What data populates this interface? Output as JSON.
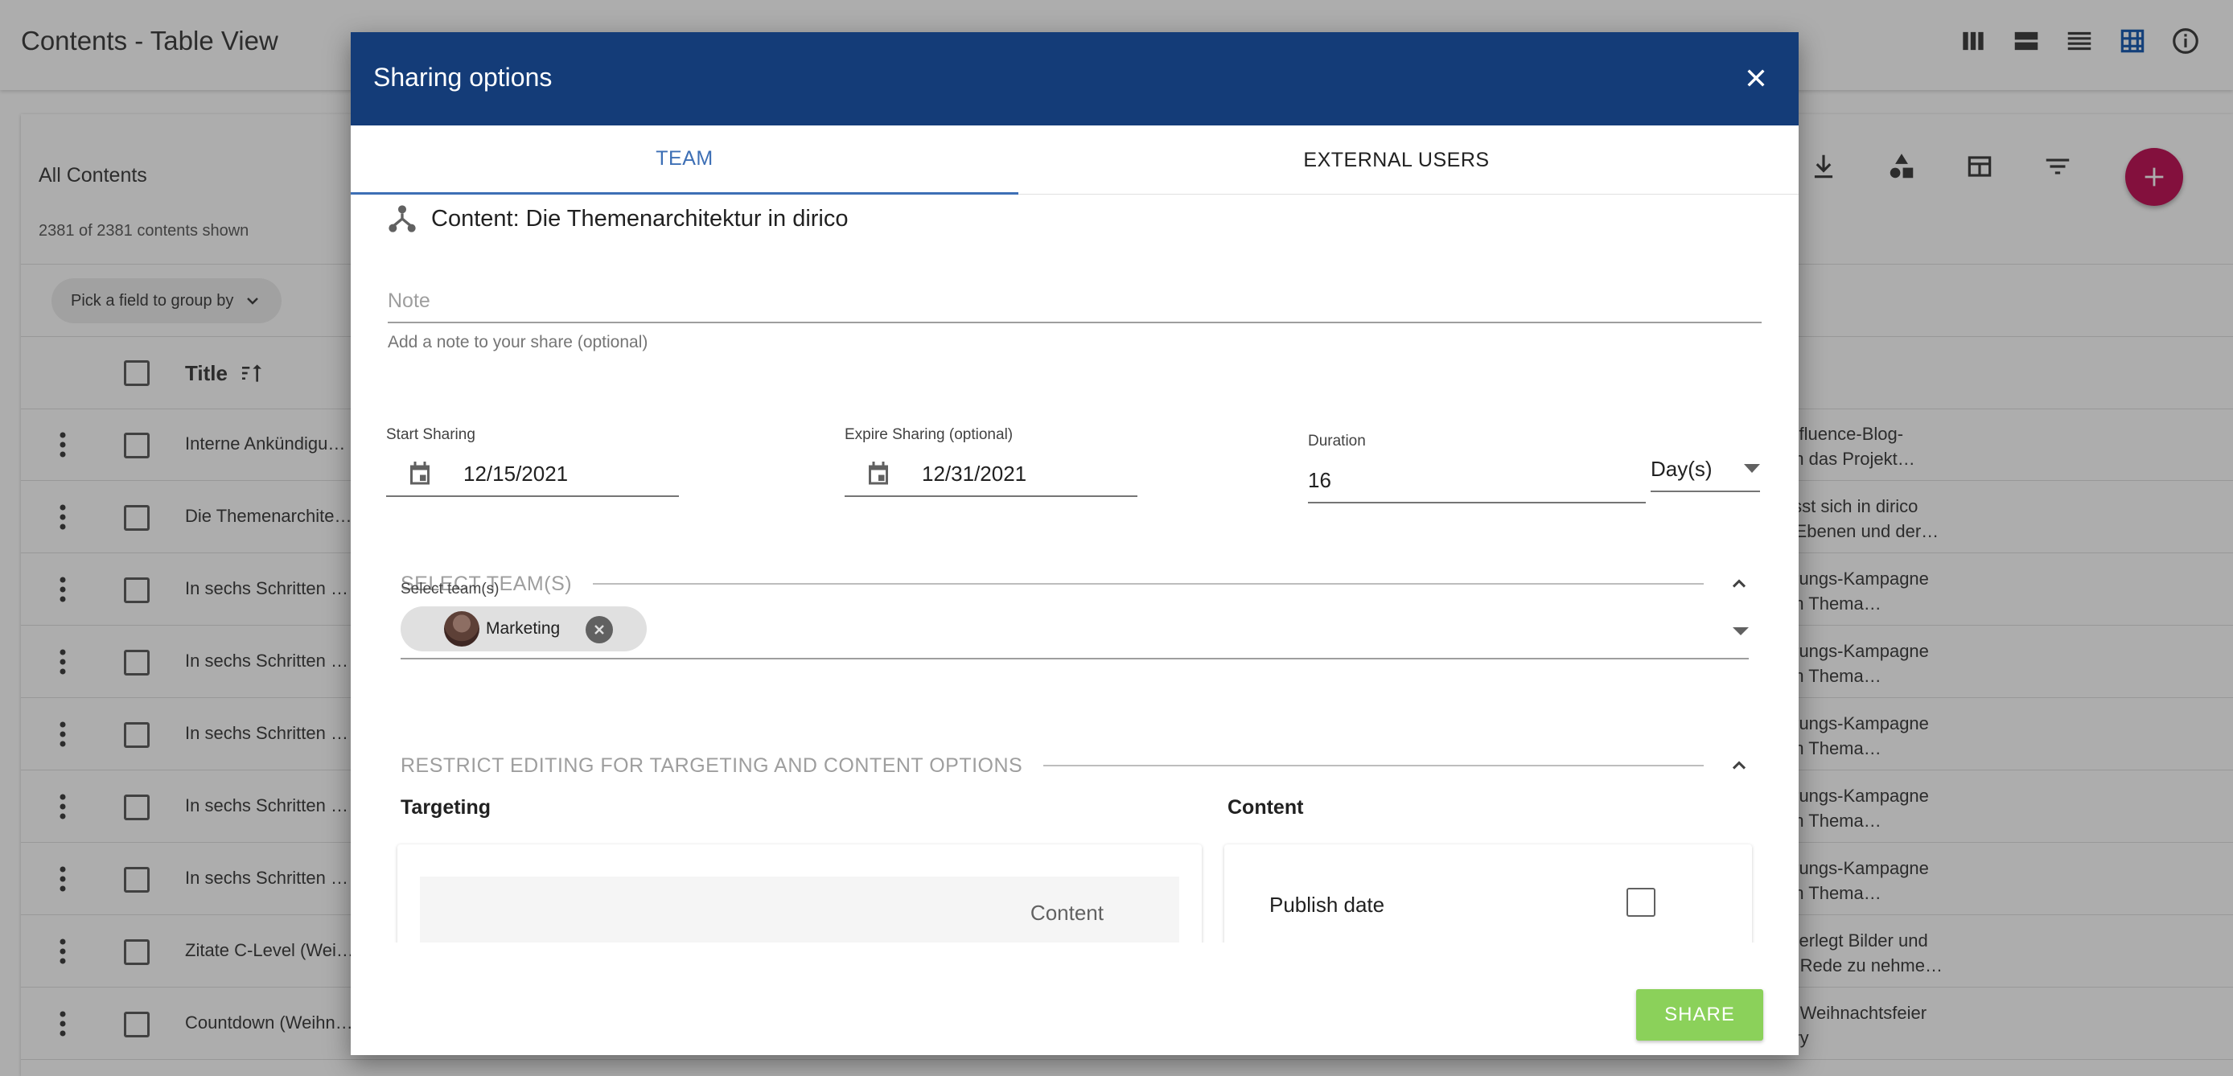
{
  "app": {
    "title": "Contents - Table View",
    "list_title": "All Contents",
    "count_text": "2381 of 2381 contents shown",
    "group_by_label": "Pick a field to group by",
    "column_title": "Title",
    "accent_color": "#c2185b"
  },
  "rows": [
    {
      "title": "Interne Ankündigu…",
      "desc1": "onfluence-Blog-",
      "desc2": "am das Projekt…"
    },
    {
      "title": "Die Themenarchite…",
      "desc1": "lässt sich in dirico",
      "desc2": "e-Ebenen und der…"
    },
    {
      "title": "In sechs Schritten …",
      "desc1": "ierungs-Kampagne",
      "desc2": "um Thema…"
    },
    {
      "title": "In sechs Schritten …",
      "desc1": "ierungs-Kampagne",
      "desc2": "um Thema…"
    },
    {
      "title": "In sechs Schritten …",
      "desc1": "ierungs-Kampagne",
      "desc2": "um Thema…"
    },
    {
      "title": "In sechs Schritten …",
      "desc1": "ierungs-Kampagne",
      "desc2": "um Thema…"
    },
    {
      "title": "In sechs Schritten …",
      "desc1": "ierungs-Kampagne",
      "desc2": "um Thema…"
    },
    {
      "title": "Zitate C-Level (Wei…",
      "desc1": "überlegt Bilder und",
      "desc2": "er Rede zu nehme…"
    },
    {
      "title": "Countdown (Weihn…",
      "desc1": "er Weihnachtsfeier",
      "desc2": "tory"
    }
  ],
  "dialog": {
    "title": "Sharing options",
    "header_color": "#143c78",
    "tabs": [
      {
        "label": "TEAM",
        "active": true
      },
      {
        "label": "EXTERNAL USERS",
        "active": false
      }
    ],
    "content_line": "Content: Die Themenarchitektur in dirico",
    "note": {
      "placeholder": "Note",
      "value": "",
      "hint": "Add a note to your share (optional)"
    },
    "start_sharing": {
      "label": "Start Sharing",
      "value": "12/15/2021"
    },
    "expire_sharing": {
      "label": "Expire Sharing (optional)",
      "value": "12/31/2021"
    },
    "duration": {
      "label": "Duration",
      "value": "16",
      "unit": "Day(s)"
    },
    "select_teams_section": {
      "title": "SELECT TEAM(S)",
      "field_label": "Select team(s)",
      "chips": [
        {
          "label": "Marketing"
        }
      ]
    },
    "restrict_section": {
      "title": "RESTRICT EDITING FOR TARGETING AND CONTENT OPTIONS",
      "targeting_label": "Targeting",
      "content_label": "Content",
      "targeting_inner_header": "Content",
      "content_options": [
        {
          "label": "Publish date",
          "checked": false
        }
      ]
    },
    "share_button": "SHARE",
    "share_color": "#8bd15a"
  }
}
